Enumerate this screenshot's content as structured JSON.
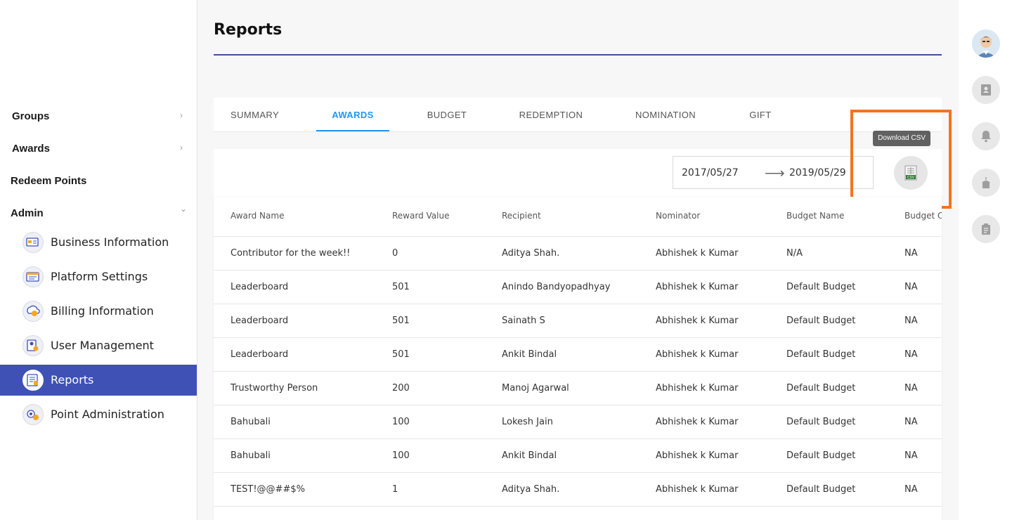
{
  "sidebar": {
    "menu": [
      {
        "label": "Groups",
        "chevron": "›"
      },
      {
        "label": "Awards",
        "chevron": "›"
      },
      {
        "label": "Redeem Points"
      },
      {
        "label": "Admin",
        "chevron": "⌄"
      }
    ],
    "admin_items": [
      {
        "label": "Business Information",
        "icon": "business-info-icon"
      },
      {
        "label": "Platform Settings",
        "icon": "platform-settings-icon"
      },
      {
        "label": "Billing Information",
        "icon": "billing-icon"
      },
      {
        "label": "User Management",
        "icon": "user-management-icon"
      },
      {
        "label": "Reports",
        "icon": "reports-icon",
        "active": true
      },
      {
        "label": "Point Administration",
        "icon": "point-admin-icon"
      }
    ]
  },
  "page": {
    "title": "Reports"
  },
  "tabs": [
    {
      "label": "SUMMARY"
    },
    {
      "label": "AWARDS",
      "active": true
    },
    {
      "label": "BUDGET"
    },
    {
      "label": "REDEMPTION"
    },
    {
      "label": "NOMINATION"
    },
    {
      "label": "GIFT"
    }
  ],
  "filter": {
    "start_date": "2017/05/27",
    "arrow": "⟶",
    "end_date": "2019/05/29",
    "csv_tooltip": "Download CSV",
    "csv_icon_text": "CSV"
  },
  "table": {
    "columns": [
      "Award Name",
      "Reward Value",
      "Recipient",
      "Nominator",
      "Budget Name",
      "Budget Ow"
    ],
    "rows": [
      [
        "Contributor for the week!!",
        "0",
        "Aditya Shah.",
        "Abhishek k Kumar",
        "N/A",
        "NA"
      ],
      [
        "Leaderboard",
        "501",
        "Anindo Bandyopadhyay",
        "Abhishek k Kumar",
        "Default Budget",
        "NA"
      ],
      [
        "Leaderboard",
        "501",
        "Sainath S",
        "Abhishek k Kumar",
        "Default Budget",
        "NA"
      ],
      [
        "Leaderboard",
        "501",
        "Ankit Bindal",
        "Abhishek k Kumar",
        "Default Budget",
        "NA"
      ],
      [
        "Trustworthy Person",
        "200",
        "Manoj Agarwal",
        "Abhishek k Kumar",
        "Default Budget",
        "NA"
      ],
      [
        "Bahubali",
        "100",
        "Lokesh Jain",
        "Abhishek k Kumar",
        "Default Budget",
        "NA"
      ],
      [
        "Bahubali",
        "100",
        "Ankit Bindal",
        "Abhishek k Kumar",
        "Default Budget",
        "NA"
      ],
      [
        "TEST!@@##$%",
        "1",
        "Aditya Shah.",
        "Abhishek k Kumar",
        "Default Budget",
        "NA"
      ]
    ]
  },
  "right_rail": {
    "items": [
      "avatar",
      "contacts-icon",
      "bell-icon",
      "cake-icon",
      "clipboard-icon"
    ]
  },
  "colors": {
    "accent": "#3f51b5",
    "tab_active": "#2196f3",
    "highlight": "#f07422"
  }
}
